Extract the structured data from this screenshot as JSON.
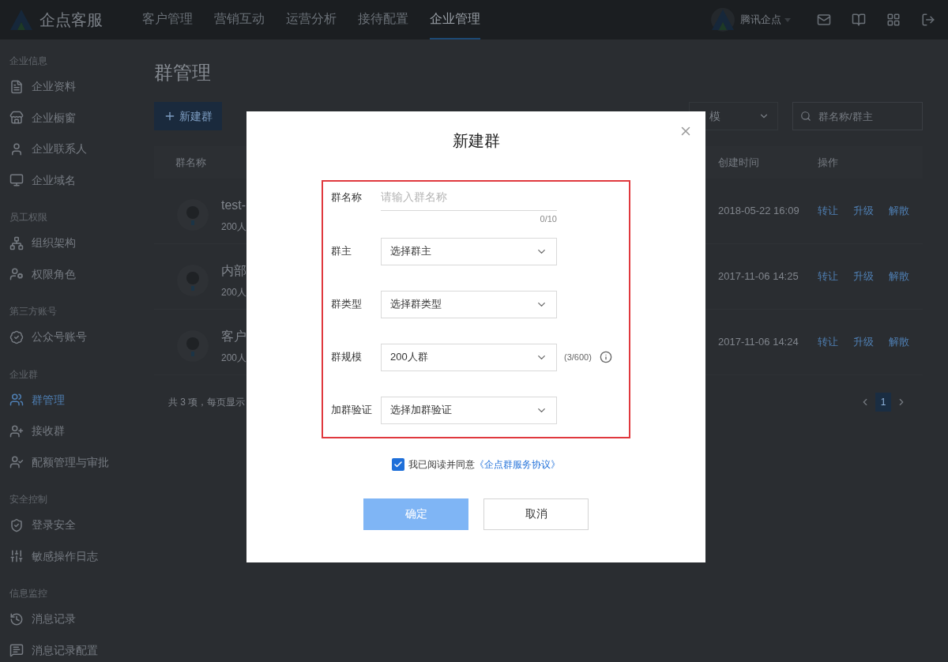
{
  "topnav": {
    "logo": "企点客服",
    "menus": [
      {
        "label": "客户管理",
        "selected": false
      },
      {
        "label": "营销互动",
        "selected": false
      },
      {
        "label": "运营分析",
        "selected": false
      },
      {
        "label": "接待配置",
        "selected": false
      },
      {
        "label": "企业管理",
        "selected": true
      }
    ],
    "account": "腾讯企点"
  },
  "sidebar": {
    "sections": [
      {
        "title": "企业信息",
        "items": [
          {
            "label": "企业资料",
            "selected": false
          },
          {
            "label": "企业橱窗",
            "selected": false
          },
          {
            "label": "企业联系人",
            "selected": false
          },
          {
            "label": "企业域名",
            "selected": false
          }
        ]
      },
      {
        "title": "员工权限",
        "items": [
          {
            "label": "组织架构",
            "selected": false
          },
          {
            "label": "权限角色",
            "selected": false
          }
        ]
      },
      {
        "title": "第三方账号",
        "items": [
          {
            "label": "公众号账号",
            "selected": false
          }
        ]
      },
      {
        "title": "企业群",
        "items": [
          {
            "label": "群管理",
            "selected": true
          },
          {
            "label": "接收群",
            "selected": false
          },
          {
            "label": "配额管理与审批",
            "selected": false
          }
        ]
      },
      {
        "title": "安全控制",
        "items": [
          {
            "label": "登录安全",
            "selected": false
          },
          {
            "label": "敏感操作日志",
            "selected": false
          }
        ]
      },
      {
        "title": "信息监控",
        "items": [
          {
            "label": "消息记录",
            "selected": false
          },
          {
            "label": "消息记录配置",
            "selected": false
          }
        ]
      }
    ]
  },
  "page": {
    "title": "群管理",
    "new_button": "新建群",
    "filter_select": {
      "value": "模"
    },
    "search": {
      "placeholder": "群名称/群主"
    },
    "table": {
      "columns": [
        "群名称",
        "创建时间",
        "操作"
      ],
      "rows": [
        {
          "name": "test-",
          "member_info": "200人",
          "created": "2018-05-22 16:09",
          "actions": [
            "转让",
            "升级",
            "解散"
          ]
        },
        {
          "name": "内部",
          "member_info": "200人",
          "created": "2017-11-06 14:25",
          "actions": [
            "转让",
            "升级",
            "解散"
          ]
        },
        {
          "name": "客户",
          "member_info": "200人",
          "created": "2017-11-06 14:24",
          "actions": [
            "转让",
            "升级",
            "解散"
          ]
        }
      ]
    },
    "footer": "共 3 项，每页显示",
    "pagination": {
      "pages": [
        {
          "label": "1",
          "selected": true
        }
      ]
    }
  },
  "dialog": {
    "title": "新建群",
    "fields": [
      {
        "kind": "text",
        "label": "群名称",
        "placeholder": "请输入群名称",
        "counter": "0/10"
      },
      {
        "kind": "select",
        "label": "群主",
        "value": "选择群主"
      },
      {
        "kind": "select",
        "label": "群类型",
        "value": "选择群类型"
      },
      {
        "kind": "select",
        "label": "群规模",
        "value": "200人群",
        "note": "(3/600)"
      },
      {
        "kind": "select",
        "label": "加群验证",
        "value": "选择加群验证"
      }
    ],
    "agreement": {
      "checked": true,
      "text": "我已阅读并同意",
      "link": "《企点群服务协议》"
    },
    "buttons": [
      {
        "label": "确定",
        "kind": "primary",
        "disabled": true
      },
      {
        "label": "取消",
        "kind": "default",
        "disabled": false
      }
    ]
  }
}
